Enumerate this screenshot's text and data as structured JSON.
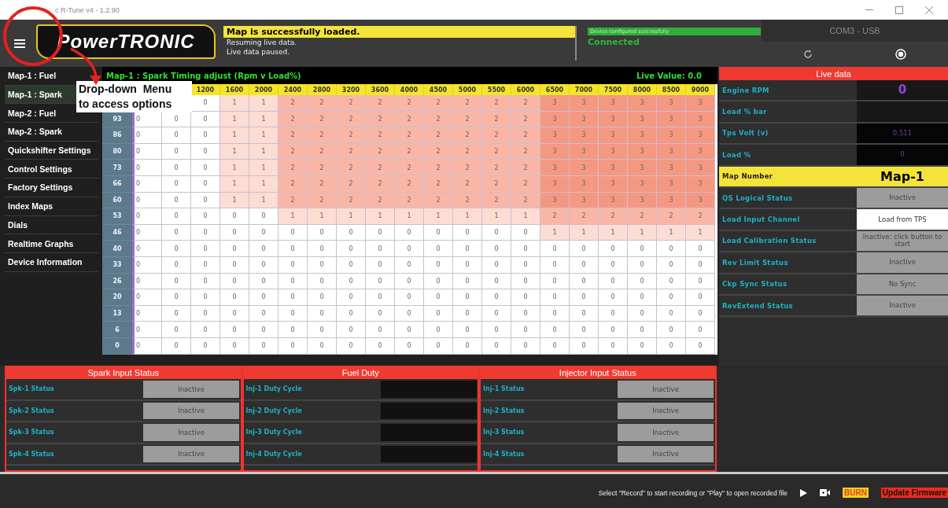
{
  "window": {
    "title": "c R-Tune v4 - 1.2.90"
  },
  "header": {
    "logo": "PowerTRONIC",
    "message": "Map is successfully loaded.",
    "sub_messages": [
      "Resuming live data.",
      "Live data paused."
    ],
    "device_status": "Device configured successfully",
    "connection": "Connected",
    "port": "COM3 - USB"
  },
  "sidebar": {
    "items": [
      {
        "label": "Map-1 : Fuel",
        "selected": false
      },
      {
        "label": "Map-1 : Spark",
        "selected": true
      },
      {
        "label": "Map-2 : Fuel",
        "selected": false
      },
      {
        "label": "Map-2 : Spark",
        "selected": false
      },
      {
        "label": "Quickshifter Settings",
        "selected": false
      },
      {
        "label": "Control Settings",
        "selected": false
      },
      {
        "label": "Factory Settings",
        "selected": false
      },
      {
        "label": "Index Maps",
        "selected": false
      },
      {
        "label": "Dials",
        "selected": false
      },
      {
        "label": "Realtime Graphs",
        "selected": false
      },
      {
        "label": "Device Information",
        "selected": false
      }
    ]
  },
  "annotation": {
    "text": "Drop-down  Menu to access options"
  },
  "map_table": {
    "title": "Map-1 : Spark Timing adjust (Rpm v Load%)",
    "live_value": "Live Value: 0.0",
    "columns": [
      "1200",
      "1600",
      "2000",
      "2400",
      "2800",
      "3200",
      "3600",
      "4000",
      "4500",
      "5000",
      "5500",
      "6000",
      "6500",
      "7000",
      "7500",
      "8000",
      "8500",
      "9000"
    ],
    "rows": [
      {
        "values": [
          "0",
          "1",
          "1",
          "2",
          "2",
          "2",
          "2",
          "2",
          "2",
          "2",
          "2",
          "2",
          "3",
          "3",
          "3",
          "3",
          "3",
          "3"
        ]
      },
      {
        "load": "93",
        "values": [
          "0",
          "0",
          "0",
          "1",
          "1",
          "2",
          "2",
          "2",
          "2",
          "2",
          "2",
          "2",
          "2",
          "2",
          "3",
          "3",
          "3",
          "3",
          "3",
          "3"
        ]
      },
      {
        "load": "86",
        "values": [
          "0",
          "0",
          "0",
          "1",
          "1",
          "2",
          "2",
          "2",
          "2",
          "2",
          "2",
          "2",
          "2",
          "2",
          "3",
          "3",
          "3",
          "3",
          "3",
          "3"
        ]
      },
      {
        "load": "80",
        "values": [
          "0",
          "0",
          "0",
          "1",
          "1",
          "2",
          "2",
          "2",
          "2",
          "2",
          "2",
          "2",
          "2",
          "2",
          "3",
          "3",
          "3",
          "3",
          "3",
          "3"
        ]
      },
      {
        "load": "73",
        "values": [
          "0",
          "0",
          "0",
          "1",
          "1",
          "2",
          "2",
          "2",
          "2",
          "2",
          "2",
          "2",
          "2",
          "2",
          "3",
          "3",
          "3",
          "3",
          "3",
          "3"
        ]
      },
      {
        "load": "66",
        "values": [
          "0",
          "0",
          "0",
          "1",
          "1",
          "2",
          "2",
          "2",
          "2",
          "2",
          "2",
          "2",
          "2",
          "2",
          "3",
          "3",
          "3",
          "3",
          "3",
          "3"
        ]
      },
      {
        "load": "60",
        "values": [
          "0",
          "0",
          "0",
          "1",
          "1",
          "2",
          "2",
          "2",
          "2",
          "2",
          "2",
          "2",
          "2",
          "2",
          "3",
          "3",
          "3",
          "3",
          "3",
          "3"
        ]
      },
      {
        "load": "53",
        "values": [
          "0",
          "0",
          "0",
          "0",
          "0",
          "1",
          "1",
          "1",
          "1",
          "1",
          "1",
          "1",
          "1",
          "1",
          "2",
          "2",
          "2",
          "2",
          "2",
          "2"
        ]
      },
      {
        "load": "46",
        "values": [
          "0",
          "0",
          "0",
          "0",
          "0",
          "0",
          "0",
          "0",
          "0",
          "0",
          "0",
          "0",
          "0",
          "0",
          "1",
          "1",
          "1",
          "1",
          "1",
          "1"
        ]
      },
      {
        "load": "40",
        "values": [
          "0",
          "0",
          "0",
          "0",
          "0",
          "0",
          "0",
          "0",
          "0",
          "0",
          "0",
          "0",
          "0",
          "0",
          "0",
          "0",
          "0",
          "0",
          "0",
          "0"
        ]
      },
      {
        "load": "33",
        "values": [
          "0",
          "0",
          "0",
          "0",
          "0",
          "0",
          "0",
          "0",
          "0",
          "0",
          "0",
          "0",
          "0",
          "0",
          "0",
          "0",
          "0",
          "0",
          "0",
          "0"
        ]
      },
      {
        "load": "26",
        "values": [
          "0",
          "0",
          "0",
          "0",
          "0",
          "0",
          "0",
          "0",
          "0",
          "0",
          "0",
          "0",
          "0",
          "0",
          "0",
          "0",
          "0",
          "0",
          "0",
          "0"
        ]
      },
      {
        "load": "20",
        "values": [
          "0",
          "0",
          "0",
          "0",
          "0",
          "0",
          "0",
          "0",
          "0",
          "0",
          "0",
          "0",
          "0",
          "0",
          "0",
          "0",
          "0",
          "0",
          "0",
          "0"
        ]
      },
      {
        "load": "13",
        "values": [
          "0",
          "0",
          "0",
          "0",
          "0",
          "0",
          "0",
          "0",
          "0",
          "0",
          "0",
          "0",
          "0",
          "0",
          "0",
          "0",
          "0",
          "0",
          "0",
          "0"
        ]
      },
      {
        "load": "6",
        "values": [
          "0",
          "0",
          "0",
          "0",
          "0",
          "0",
          "0",
          "0",
          "0",
          "0",
          "0",
          "0",
          "0",
          "0",
          "0",
          "0",
          "0",
          "0",
          "0",
          "0"
        ]
      },
      {
        "load": "0",
        "values": [
          "0",
          "0",
          "0",
          "0",
          "0",
          "0",
          "0",
          "0",
          "0",
          "0",
          "0",
          "0",
          "0",
          "0",
          "0",
          "0",
          "0",
          "0",
          "0",
          "0"
        ]
      }
    ]
  },
  "live_data": {
    "title": "Live data",
    "rows": [
      {
        "label": "Engine RPM",
        "kind": "counter",
        "value": "0"
      },
      {
        "label": "Load % bar",
        "kind": "bar"
      },
      {
        "label": "Tps Volt (v)",
        "kind": "reading",
        "value": "0.511"
      },
      {
        "label": "Load %",
        "kind": "reading",
        "value": "0"
      },
      {
        "label": "Map Number",
        "kind": "map",
        "value": "Map-1"
      },
      {
        "label": "QS Logical Status",
        "kind": "status",
        "value": "Inactive"
      },
      {
        "label": "Load Input Channel",
        "kind": "choice",
        "value": "Load from TPS"
      },
      {
        "label": "Load Calibration Status",
        "kind": "status",
        "value": "Inactive: click button to start"
      },
      {
        "label": "Rev Limit Status",
        "kind": "status",
        "value": "Inactive"
      },
      {
        "label": "Ckp Sync Status",
        "kind": "status",
        "value": "No Sync"
      },
      {
        "label": "RevExtend Status",
        "kind": "status",
        "value": "Inactive"
      }
    ]
  },
  "panels": [
    {
      "title": "Spark Input Status",
      "rows": [
        {
          "label": "Spk-1 Status",
          "kind": "status",
          "value": "Inactive"
        },
        {
          "label": "Spk-2 Status",
          "kind": "status",
          "value": "Inactive"
        },
        {
          "label": "Spk-3 Status",
          "kind": "status",
          "value": "Inactive"
        },
        {
          "label": "Spk-4 Status",
          "kind": "status",
          "value": "Inactive"
        }
      ]
    },
    {
      "title": "Fuel Duty",
      "rows": [
        {
          "label": "Inj-1 Duty Cycle",
          "kind": "bar"
        },
        {
          "label": "Inj-2 Duty Cycle",
          "kind": "bar"
        },
        {
          "label": "Inj-3 Duty Cycle",
          "kind": "bar"
        },
        {
          "label": "Inj-4 Duty Cycle",
          "kind": "bar"
        }
      ]
    },
    {
      "title": "Injector Input Status",
      "rows": [
        {
          "label": "Inj-1 Status",
          "kind": "status",
          "value": "Inactive"
        },
        {
          "label": "Inj-2 Status",
          "kind": "status",
          "value": "Inactive"
        },
        {
          "label": "Inj-3 Status",
          "kind": "status",
          "value": "Inactive"
        },
        {
          "label": "Inj-4 Status",
          "kind": "status",
          "value": "Inactive"
        }
      ]
    }
  ],
  "footer": {
    "hint": "Select \"Record\" to start recording or \"Play\" to open recorded file",
    "burn": "BURN",
    "update": "Update Firmware"
  }
}
